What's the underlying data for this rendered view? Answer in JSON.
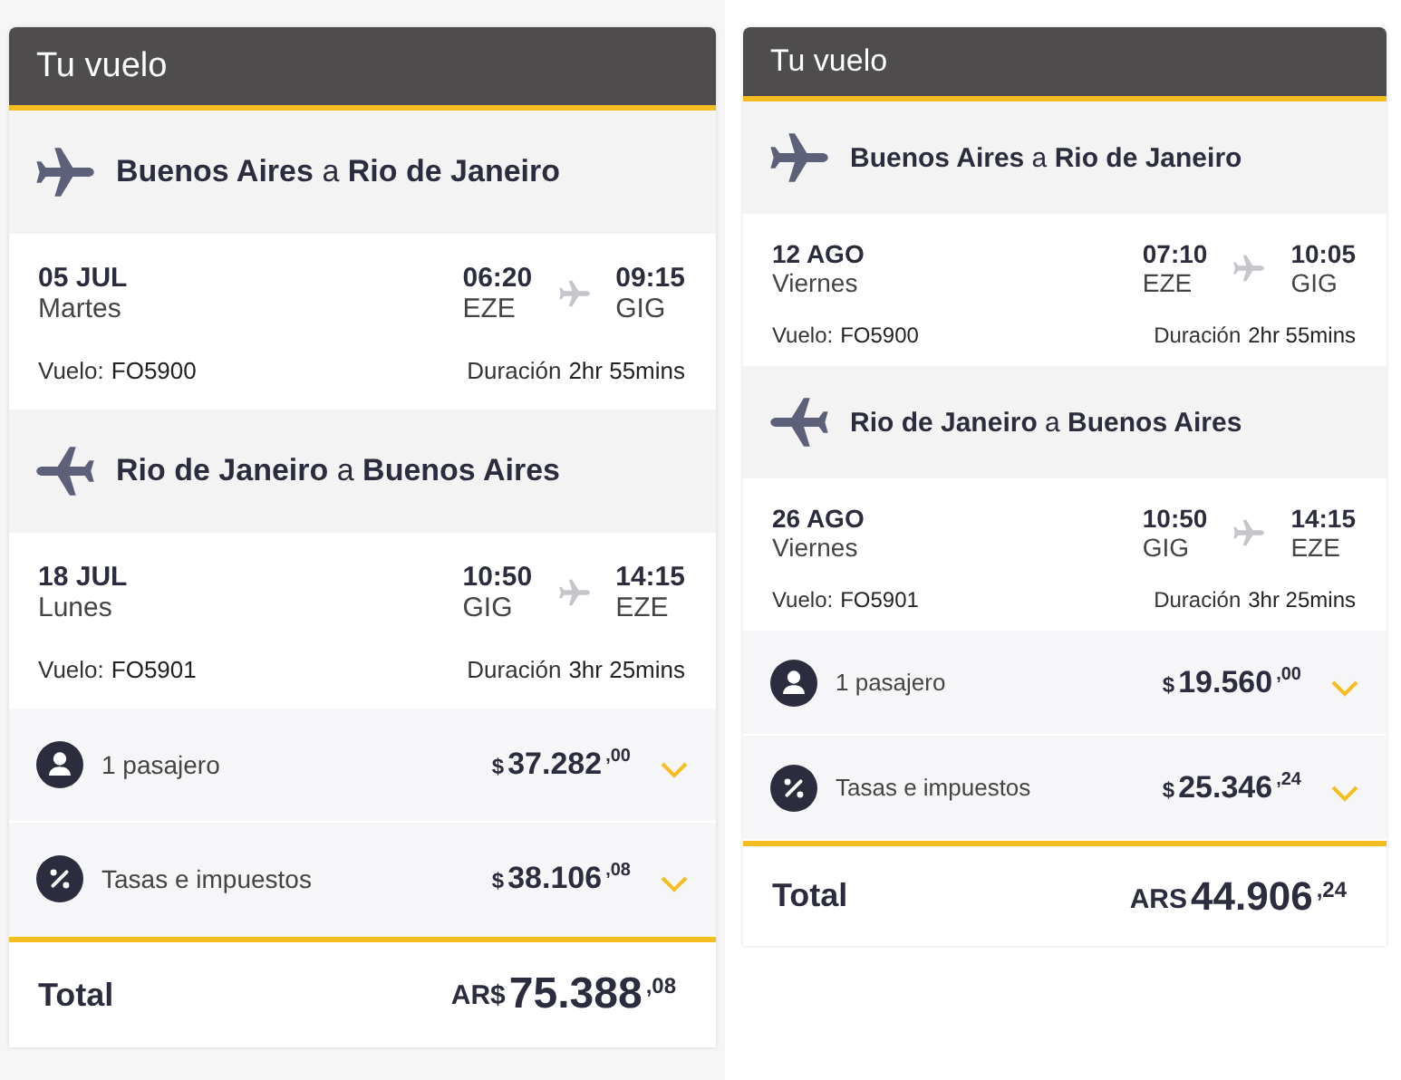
{
  "panels": [
    {
      "title": "Tu vuelo",
      "legs": [
        {
          "kind": "outbound",
          "route": "**Buenos Aires** a **Rio de Janeiro**",
          "date": "05 JUL",
          "weekday": "Martes",
          "depart_time": "06:20",
          "depart_code": "EZE",
          "arrive_time": "09:15",
          "arrive_code": "GIG",
          "flight_label": "Vuelo:",
          "flight_number": "FO5900",
          "duration_label": "Duración",
          "duration": "2hr 55mins"
        },
        {
          "kind": "return",
          "route": "**Rio de Janeiro** a **Buenos Aires**",
          "date": "18 JUL",
          "weekday": "Lunes",
          "depart_time": "10:50",
          "depart_code": "GIG",
          "arrive_time": "14:15",
          "arrive_code": "EZE",
          "flight_label": "Vuelo:",
          "flight_number": "FO5901",
          "duration_label": "Duración",
          "duration": "3hr 25mins"
        }
      ],
      "charges": [
        {
          "kind": "passenger",
          "label": "1 pasajero",
          "currency": "$",
          "amount": "37.282",
          "cents": ",00"
        },
        {
          "kind": "taxes",
          "label": "Tasas e impuestos",
          "currency": "$",
          "amount": "38.106",
          "cents": ",08"
        }
      ],
      "total": {
        "label": "Total",
        "currency": "AR$",
        "amount": "75.388",
        "cents": ",08"
      }
    },
    {
      "title": "Tu vuelo",
      "legs": [
        {
          "kind": "outbound",
          "route": "**Buenos Aires** a **Rio de Janeiro**",
          "date": "12 AGO",
          "weekday": "Viernes",
          "depart_time": "07:10",
          "depart_code": "EZE",
          "arrive_time": "10:05",
          "arrive_code": "GIG",
          "flight_label": "Vuelo:",
          "flight_number": "FO5900",
          "duration_label": "Duración",
          "duration": "2hr 55mins"
        },
        {
          "kind": "return",
          "route": "**Rio de Janeiro** a **Buenos Aires**",
          "date": "26 AGO",
          "weekday": "Viernes",
          "depart_time": "10:50",
          "depart_code": "GIG",
          "arrive_time": "14:15",
          "arrive_code": "EZE",
          "flight_label": "Vuelo:",
          "flight_number": "FO5901",
          "duration_label": "Duración",
          "duration": "3hr 25mins"
        }
      ],
      "charges": [
        {
          "kind": "passenger",
          "label": "1 pasajero",
          "currency": "$",
          "amount": "19.560",
          "cents": ",00"
        },
        {
          "kind": "taxes",
          "label": "Tasas e impuestos",
          "currency": "$",
          "amount": "25.346",
          "cents": ",24"
        }
      ],
      "total": {
        "label": "Total",
        "currency": "ARS",
        "amount": "44.906",
        "cents": ",24"
      }
    }
  ]
}
